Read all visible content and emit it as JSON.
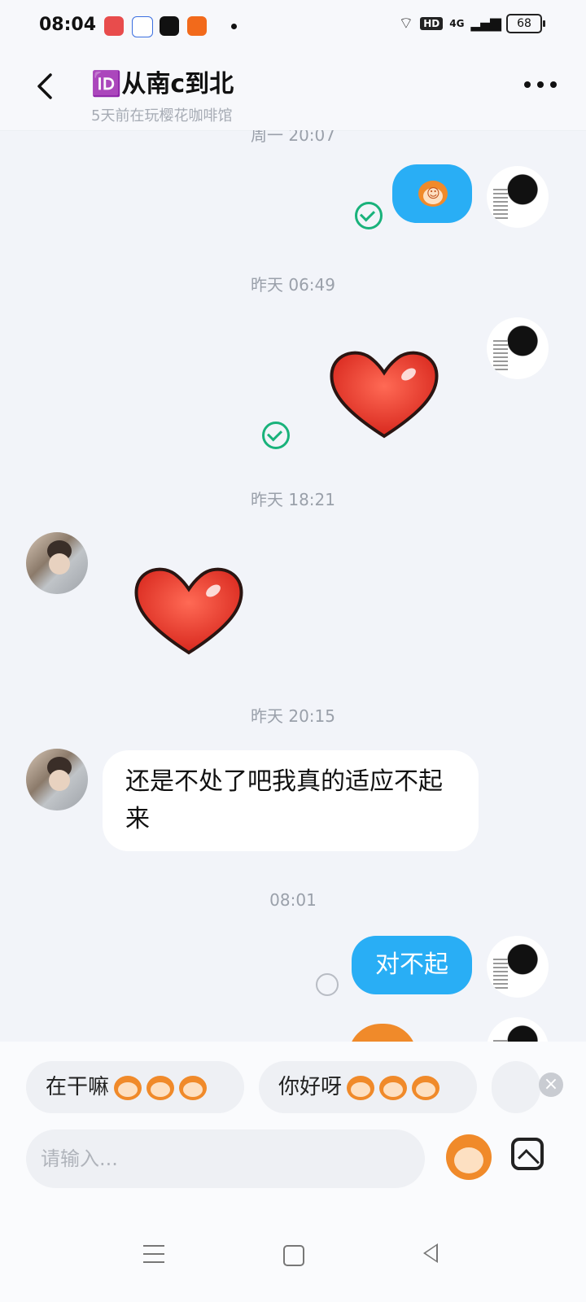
{
  "status_bar": {
    "time": "08:04",
    "battery": "68",
    "hd": "HD",
    "network": "4G"
  },
  "header": {
    "title_icon": "🆔",
    "title": "从南c到北",
    "subtitle": "5天前在玩樱花咖啡馆",
    "more_label": "more-options"
  },
  "messages": {
    "ts1": "周一 20:07",
    "ts2": "昨天 06:49",
    "ts3": "昨天 18:21",
    "ts4": "昨天 20:15",
    "ts5": "08:01",
    "their_text": "还是不处了吧我真的适应不起来",
    "my_text": "对不起"
  },
  "suggestions": {
    "chip1": "在干嘛",
    "chip2": "你好呀"
  },
  "composer": {
    "placeholder": "请输入..."
  },
  "colors": {
    "bubble_blue": "#29aef5",
    "check_green": "#19b27b"
  }
}
